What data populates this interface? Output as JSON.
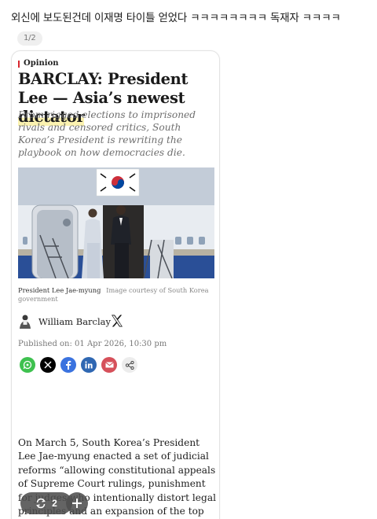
{
  "post": {
    "title": "외신에 보도된건데  이재명 타이틀 얻었다 ㅋㅋㅋㅋㅋㅋㅋㅋ 독재자 ㅋㅋㅋㅋ",
    "page_indicator": "1/2"
  },
  "article": {
    "section": "Opinion",
    "headline_prefix": "BARCLAY: President Lee — Asia’s newest ",
    "headline_highlight": "dictator",
    "dek": "From rigged elections to imprisoned rivals and censored critics, South Korea’s President is rewriting the playbook on how democracies die.",
    "caption_name": "President Lee Jae-myung",
    "caption_credit": "Image courtesy of South Korea government",
    "author": "William Barclay",
    "published": "Published on: 01 Apr 2026, 10:30 pm",
    "body": "On March 5, South Korea’s President Lee Jae-myung enacted a set of judicial reforms “allowing constitutional appeals of Supreme Court rulings, punishment for judges who intentionally distort legal principles and an expansion of the top",
    "share_icons": [
      "whatsapp-icon",
      "x-icon",
      "facebook-icon",
      "linkedin-icon",
      "email-icon",
      "share-icon"
    ]
  },
  "controls": {
    "repost_count": "2"
  },
  "colors": {
    "accent_red": "#d8262e",
    "highlight": "#fbf2b0",
    "whatsapp": "#3ec14f",
    "x": "#000000",
    "facebook": "#3b73df",
    "linkedin": "#2f67b2",
    "email": "#d6505a",
    "share": "#ececec"
  }
}
